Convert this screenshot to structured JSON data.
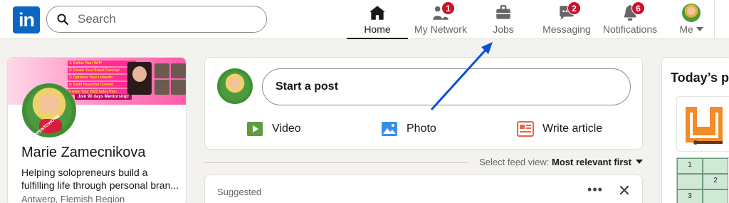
{
  "nav": {
    "logo_text": "in",
    "search_placeholder": "Search",
    "items": [
      {
        "label": "Home",
        "icon": "home-icon",
        "badge": ""
      },
      {
        "label": "My Network",
        "icon": "my-network-icon",
        "badge": "1"
      },
      {
        "label": "Jobs",
        "icon": "jobs-icon",
        "badge": ""
      },
      {
        "label": "Messaging",
        "icon": "messaging-icon",
        "badge": "2"
      },
      {
        "label": "Notifications",
        "icon": "notifications-icon",
        "badge": "6"
      },
      {
        "label": "Me",
        "icon": "me-avatar",
        "badge": ""
      }
    ]
  },
  "profile": {
    "name": "Marie Zamecnikova",
    "headline": "Helping solopreneurs build a fulfilling life through personal bran...",
    "location": "Antwerp, Flemish Region",
    "banner": {
      "steps": [
        "1: Define Your WHY",
        "2: Create Your Brand Concept",
        "3: Optimize Your LinkedIn",
        "4: Build Impactful Content",
        "Create Your 2023 Sales Plan"
      ],
      "cta": "Join 90 days Mentorship!",
      "avatar_ring_text": "#OPENTOWORK"
    }
  },
  "share": {
    "start_post": "Start a post",
    "actions": [
      {
        "label": "Video",
        "icon": "video-icon",
        "color": "#5f9b41"
      },
      {
        "label": "Photo",
        "icon": "photo-icon",
        "color": "#378fe9"
      },
      {
        "label": "Write article",
        "icon": "article-icon",
        "color": "#e06847"
      }
    ]
  },
  "feed": {
    "select_label": "Select feed view:",
    "select_value": "Most relevant first",
    "suggested": "Suggested",
    "more": "•••",
    "close": "✕"
  },
  "puzzles": {
    "title": "Today’s pu",
    "grid_numbers": [
      "1",
      "",
      "",
      "2",
      "3",
      ""
    ]
  },
  "colors": {
    "brand": "#0a66c2",
    "badge": "#cb112d",
    "arrow": "#0a4fd6"
  }
}
